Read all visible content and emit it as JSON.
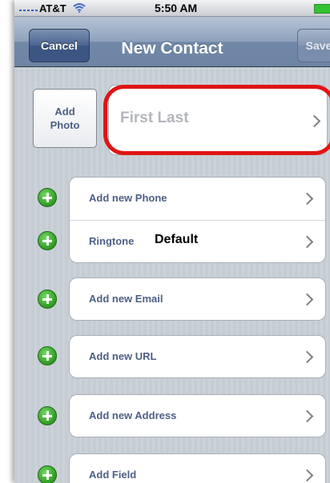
{
  "status_bar": {
    "carrier": "AT&T",
    "time": "5:50 AM"
  },
  "nav": {
    "title": "New Contact",
    "cancel_label": "Cancel",
    "save_label": "Save"
  },
  "photo": {
    "label_line1": "Add",
    "label_line2": "Photo"
  },
  "name": {
    "placeholder": "First Last"
  },
  "rows": {
    "phone": "Add new Phone",
    "ringtone_label": "Ringtone",
    "ringtone_value": "Default",
    "email": "Add new Email",
    "url": "Add new URL",
    "address": "Add new Address",
    "field": "Add Field"
  },
  "colors": {
    "add_icon": "#2f9a22",
    "highlight": "#e01414",
    "nav_bar": "#7188a8"
  }
}
